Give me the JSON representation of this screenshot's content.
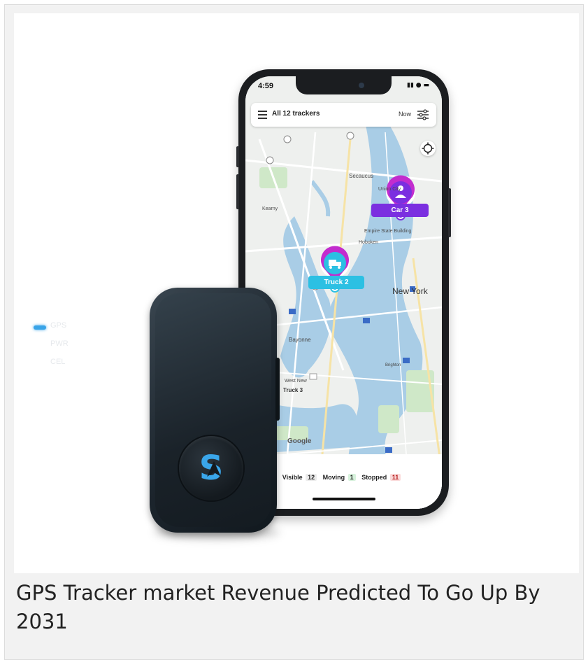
{
  "caption": "GPS Tracker market Revenue Predicted To Go Up By 2031",
  "phone": {
    "status_time": "4:59",
    "status_icons": "▮▮ ● ▬",
    "topbar": {
      "title": "All 12 trackers",
      "now_label": "Now"
    },
    "map_labels": {
      "secaucus": "Secaucus",
      "union_city": "Union City",
      "kearny": "Kearny",
      "empire_state": "Empire State Building",
      "hoboken": "Hoboken",
      "new_york": "New York",
      "bayonne": "Bayonne",
      "west_new": "West New",
      "brighton": "Brighton",
      "google": "Google"
    },
    "tags": {
      "car": "Car 3",
      "truck": "Truck 2",
      "truck_map": "Truck 3"
    },
    "stats": {
      "visible_label": "Visible",
      "visible_count": "12",
      "moving_label": "Moving",
      "moving_count": "1",
      "stopped_label": "Stopped",
      "stopped_count": "11"
    }
  },
  "tracker": {
    "led_gps": "GPS",
    "led_pwr": "PWR",
    "led_cel": "CEL",
    "logo_letter": "S"
  },
  "colors": {
    "car_tag": "#7b2fe0",
    "truck_tag": "#2cc0e3",
    "led_blue": "#39a4e8",
    "water": "#a9cde6",
    "land": "#eef0ee"
  }
}
